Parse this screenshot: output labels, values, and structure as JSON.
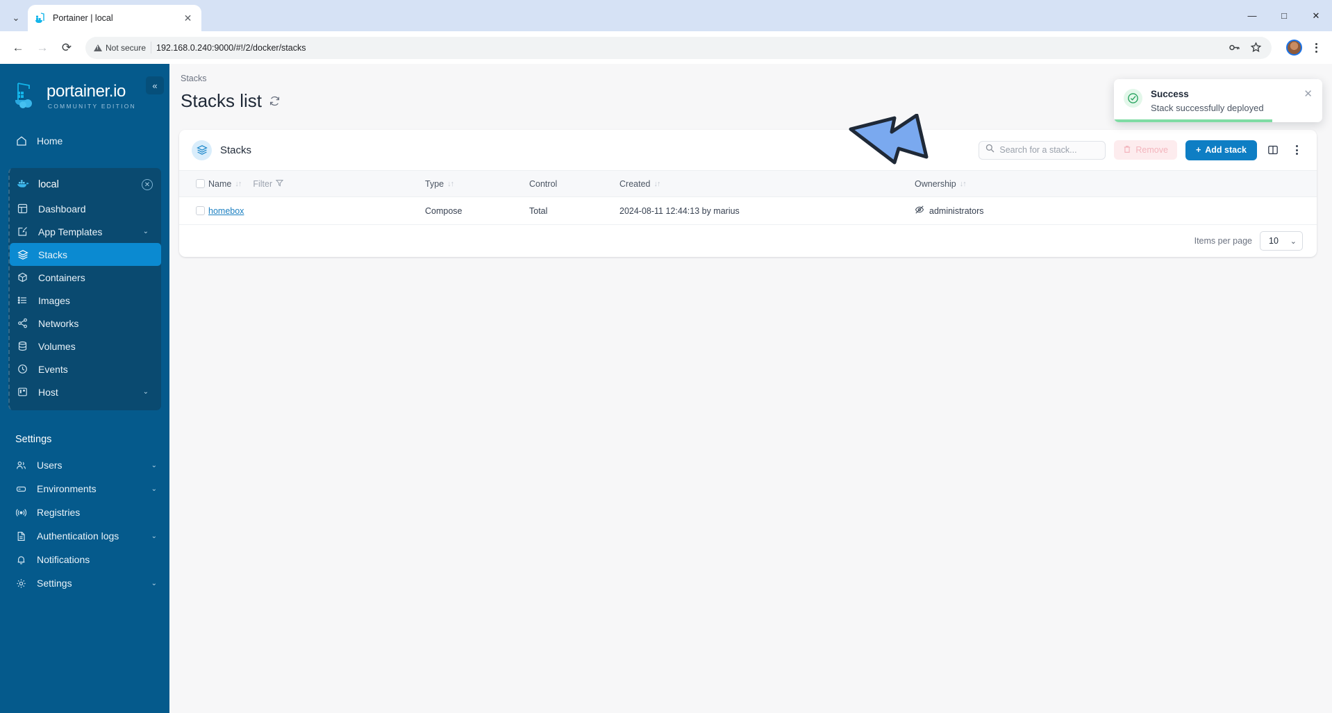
{
  "browser": {
    "tab_title": "Portainer | local",
    "tab_favicon_name": "portainer-favicon",
    "url": "192.168.0.240:9000/#!/2/docker/stacks",
    "security_label": "Not secure",
    "back_icon": "←",
    "forward_icon": "→",
    "reload_icon": "⟳",
    "minimize_icon": "—",
    "maximize_icon": "□",
    "close_icon": "✕",
    "tab_close_icon": "✕",
    "tablist_chevron": "⌄",
    "key_icon": "key-icon",
    "star_icon": "☆"
  },
  "sidebar": {
    "logo_name": "portainer.io",
    "logo_subtitle": "COMMUNITY EDITION",
    "collapse_icon": "«",
    "home": {
      "label": "Home",
      "icon": "home-icon"
    },
    "environment": {
      "label": "local",
      "icon": "docker-icon",
      "close_icon": "✕"
    },
    "env_items": [
      {
        "label": "Dashboard",
        "icon": "dashboard-icon",
        "active": false,
        "chevron": ""
      },
      {
        "label": "App Templates",
        "icon": "template-icon",
        "active": false,
        "chevron": "⌄"
      },
      {
        "label": "Stacks",
        "icon": "stacks-icon",
        "active": true,
        "chevron": ""
      },
      {
        "label": "Containers",
        "icon": "container-icon",
        "active": false,
        "chevron": ""
      },
      {
        "label": "Images",
        "icon": "images-icon",
        "active": false,
        "chevron": ""
      },
      {
        "label": "Networks",
        "icon": "network-icon",
        "active": false,
        "chevron": ""
      },
      {
        "label": "Volumes",
        "icon": "volume-icon",
        "active": false,
        "chevron": ""
      },
      {
        "label": "Events",
        "icon": "clock-icon",
        "active": false,
        "chevron": ""
      },
      {
        "label": "Host",
        "icon": "host-icon",
        "active": false,
        "chevron": "⌄"
      }
    ],
    "settings_heading": "Settings",
    "settings_items": [
      {
        "label": "Users",
        "icon": "users-icon",
        "chevron": "⌄"
      },
      {
        "label": "Environments",
        "icon": "environments-icon",
        "chevron": "⌄"
      },
      {
        "label": "Registries",
        "icon": "registry-icon",
        "chevron": ""
      },
      {
        "label": "Authentication logs",
        "icon": "document-icon",
        "chevron": "⌄"
      },
      {
        "label": "Notifications",
        "icon": "bell-icon",
        "chevron": ""
      },
      {
        "label": "Settings",
        "icon": "gear-icon",
        "chevron": "⌄"
      }
    ]
  },
  "main": {
    "breadcrumb": "Stacks",
    "page_title": "Stacks list",
    "refresh_icon": "refresh-icon",
    "card_title": "Stacks",
    "card_icon": "stacks-icon",
    "search_placeholder": "Search for a stack...",
    "search_value": "",
    "search_icon": "search-icon",
    "remove_label": "Remove",
    "remove_icon": "trash-icon",
    "add_label": "Add stack",
    "add_icon": "+",
    "columns_icon": "columns-icon",
    "more_icon": "kebab-icon",
    "sort_icon": "↓↑",
    "filter_label": "Filter",
    "filter_icon": "filter-icon",
    "columns": [
      {
        "label": "Name",
        "sortable": true
      },
      {
        "label": "Type",
        "sortable": true
      },
      {
        "label": "Control",
        "sortable": false
      },
      {
        "label": "Created",
        "sortable": true
      },
      {
        "label": "Ownership",
        "sortable": true
      }
    ],
    "rows": [
      {
        "name": "homebox",
        "type": "Compose",
        "control": "Total",
        "created": "2024-08-11 12:44:13 by marius",
        "ownership": "administrators",
        "ownership_icon": "eye-off-icon"
      }
    ],
    "items_per_page_label": "Items per page",
    "items_per_page_value": "10",
    "select_chevron": "⌄"
  },
  "toast": {
    "title": "Success",
    "message": "Stack successfully deployed",
    "icon": "check-circle-icon",
    "close_icon": "✕",
    "accent_color": "#7fdca4"
  },
  "annotation": {
    "arrow_name": "pointer-arrow",
    "fill_color": "#7aa9ef",
    "stroke_color": "#1f2937"
  },
  "theme": {
    "sidebar_bg": "#055a8c",
    "active_item": "#0b8ad1",
    "primary_button": "#0e7ec4",
    "link": "#1a7fc1"
  }
}
